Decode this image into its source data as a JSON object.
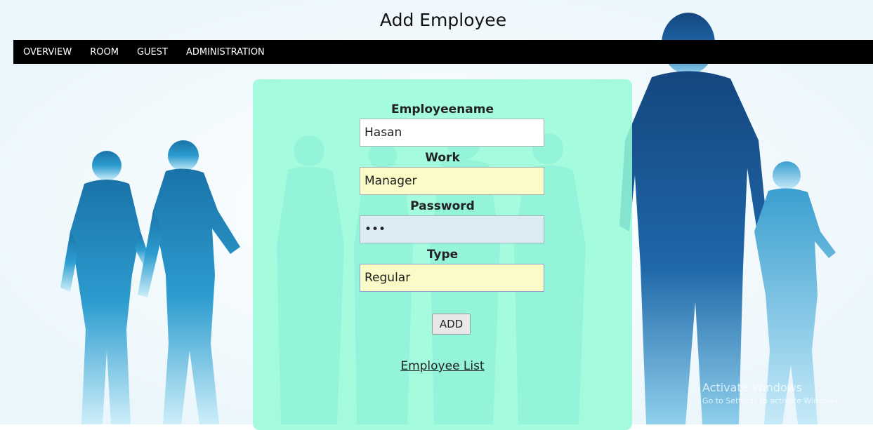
{
  "page": {
    "title": "Add Employee"
  },
  "nav": {
    "items": [
      {
        "label": "OVERVIEW"
      },
      {
        "label": "ROOM"
      },
      {
        "label": "GUEST"
      },
      {
        "label": "ADMINISTRATION"
      }
    ]
  },
  "form": {
    "employeename": {
      "label": "Employeename",
      "value": "Hasan"
    },
    "work": {
      "label": "Work",
      "value": "Manager"
    },
    "password": {
      "label": "Password",
      "value": "abc"
    },
    "type": {
      "label": "Type",
      "value": "Regular"
    },
    "add_label": "ADD",
    "employee_list_label": "Employee List"
  },
  "watermark": {
    "title": "Activate Windows",
    "subtitle": "Go to Settings to activate Windows."
  },
  "colors": {
    "navbar": "#000000",
    "card": "#96fad7",
    "silhouette_dark": "#1f5a9e",
    "silhouette_light": "#5bbbe0"
  }
}
